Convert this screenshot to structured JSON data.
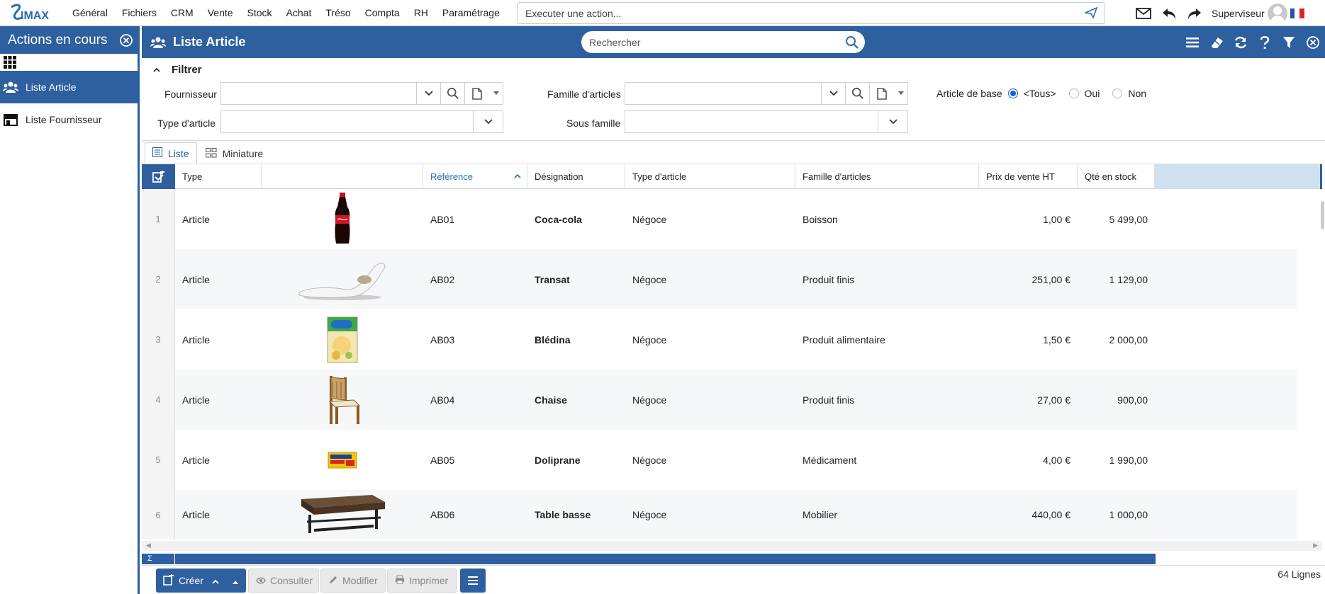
{
  "app": {
    "logo": "SIMAX",
    "menu": [
      "Général",
      "Fichiers",
      "CRM",
      "Vente",
      "Stock",
      "Achat",
      "Tréso",
      "Compta",
      "RH",
      "Paramétrage"
    ],
    "action_placeholder": "Executer une action...",
    "user": "Superviseur"
  },
  "sidebar": {
    "title": "Actions en cours",
    "items": [
      {
        "label": "Liste Article",
        "icon": "people-icon",
        "active": true
      },
      {
        "label": "Liste Fournisseur",
        "icon": "store-icon",
        "active": false
      }
    ]
  },
  "page": {
    "title": "Liste Article",
    "search_placeholder": "Rechercher"
  },
  "filter": {
    "title": "Filtrer",
    "fournisseur_label": "Fournisseur",
    "famille_label": "Famille d'articles",
    "type_label": "Type d'article",
    "sous_famille_label": "Sous famille",
    "article_base_label": "Article de base",
    "radio_options": [
      "<Tous>",
      "Oui",
      "Non"
    ],
    "radio_selected": "<Tous>"
  },
  "tabs": [
    {
      "label": "Liste",
      "active": true
    },
    {
      "label": "Miniature",
      "active": false
    }
  ],
  "table": {
    "columns": [
      "Type",
      "",
      "Référence",
      "Désignation",
      "Type d'article",
      "Famille d'articles",
      "Prix de vente HT",
      "Qté en stock"
    ],
    "sorted_column": "Référence",
    "rows": [
      {
        "n": "1",
        "type": "Article",
        "image": "coca-bottle",
        "ref": "AB01",
        "designation": "Coca-cola",
        "type_article": "Négoce",
        "famille": "Boisson",
        "prix": "1,00 €",
        "qte": "5 499,00"
      },
      {
        "n": "2",
        "type": "Article",
        "image": "lounge-chair",
        "ref": "AB02",
        "designation": "Transat",
        "type_article": "Négoce",
        "famille": "Produit finis",
        "prix": "251,00 €",
        "qte": "1 129,00"
      },
      {
        "n": "3",
        "type": "Article",
        "image": "cereal-box",
        "ref": "AB03",
        "designation": "Blédina",
        "type_article": "Négoce",
        "famille": "Produit alimentaire",
        "prix": "1,50 €",
        "qte": "2 000,00"
      },
      {
        "n": "4",
        "type": "Article",
        "image": "wood-chair",
        "ref": "AB04",
        "designation": "Chaise",
        "type_article": "Négoce",
        "famille": "Produit finis",
        "prix": "27,00 €",
        "qte": "900,00"
      },
      {
        "n": "5",
        "type": "Article",
        "image": "medicine-box",
        "ref": "AB05",
        "designation": "Doliprane",
        "type_article": "Négoce",
        "famille": "Médicament",
        "prix": "4,00 €",
        "qte": "1 990,00"
      },
      {
        "n": "6",
        "type": "Article",
        "image": "coffee-table",
        "ref": "AB06",
        "designation": "Table basse",
        "type_article": "Négoce",
        "famille": "Mobilier",
        "prix": "440,00 €",
        "qte": "1 000,00"
      }
    ],
    "sum_symbol": "Σ"
  },
  "toolbar": {
    "create": "Créer",
    "view": "Consulter",
    "edit": "Modifier",
    "print": "Imprimer",
    "line_count": "64 Lignes"
  },
  "colors": {
    "brand": "#2e5f9e",
    "accent": "#2a6db5",
    "header_fill": "#cfe0f0"
  }
}
